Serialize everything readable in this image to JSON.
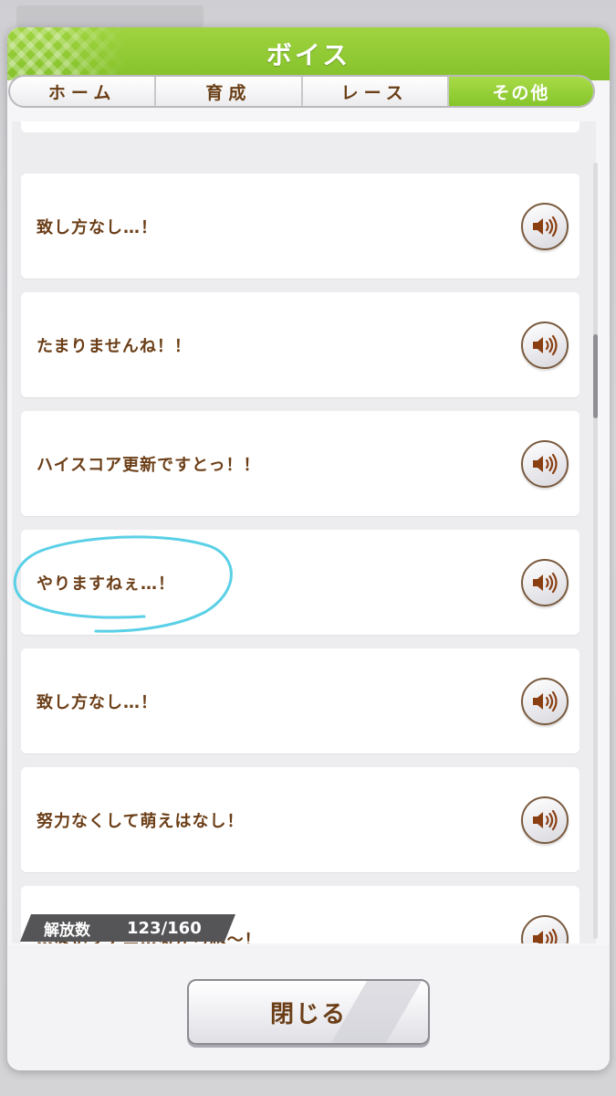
{
  "dialog": {
    "title": "ボイス"
  },
  "tabs": [
    {
      "label": "ホーム",
      "active": false
    },
    {
      "label": "育成",
      "active": false
    },
    {
      "label": "レース",
      "active": false
    },
    {
      "label": "その他",
      "active": true
    }
  ],
  "voices": [
    {
      "text": "致し方なし…！"
    },
    {
      "text": "たまりませんね！！"
    },
    {
      "text": "ハイスコア更新ですとっ！！"
    },
    {
      "text": "やりますねぇ…！"
    },
    {
      "text": "致し方なし…！"
    },
    {
      "text": "努力なくして萌えはなし！"
    },
    {
      "text": "…ないフアニ…るからね～！"
    }
  ],
  "unlock": {
    "label": "解放数",
    "count": "123/160"
  },
  "footer": {
    "close_label": "閉じる"
  },
  "colors": {
    "accent": "#8bc832",
    "text_brown": "#6b3e17",
    "annotation": "#5ad0e6"
  },
  "icons": {
    "play": "speaker-icon"
  }
}
